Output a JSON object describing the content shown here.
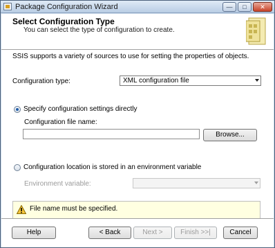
{
  "window": {
    "title": "Package Configuration Wizard"
  },
  "header": {
    "title": "Select Configuration Type",
    "subtitle": "You can select the type of configuration to create."
  },
  "intro": "SSIS supports a variety of sources to use for setting the properties of objects.",
  "config_type": {
    "label": "Configuration type:",
    "value": "XML configuration file"
  },
  "option_direct": {
    "label": "Specify configuration settings directly",
    "selected": true,
    "file_label": "Configuration file name:",
    "file_value": "",
    "browse_label": "Browse..."
  },
  "option_env": {
    "label": "Configuration location is stored in an environment variable",
    "selected": false,
    "variable_label": "Environment variable:",
    "variable_value": ""
  },
  "error": {
    "message": "File name must be specified."
  },
  "buttons": {
    "help": "Help",
    "back": "< Back",
    "next": "Next >",
    "finish": "Finish >>|",
    "cancel": "Cancel"
  }
}
